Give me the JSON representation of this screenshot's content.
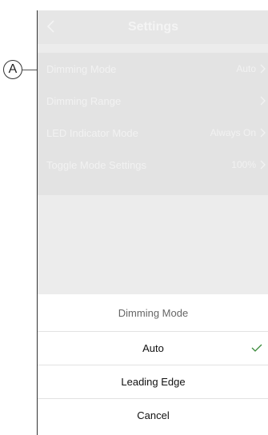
{
  "callout": {
    "label": "A"
  },
  "header": {
    "title": "Settings"
  },
  "settings": {
    "items": [
      {
        "label": "Dimming Mode",
        "value": "Auto"
      },
      {
        "label": "Dimming Range",
        "value": ""
      },
      {
        "label": "LED Indicator Mode",
        "value": "Always On"
      },
      {
        "label": "Toggle Mode Settings",
        "value": "100%"
      }
    ]
  },
  "sheet": {
    "title": "Dimming Mode",
    "options": [
      {
        "label": "Auto",
        "selected": true
      },
      {
        "label": "Leading Edge",
        "selected": false
      }
    ],
    "cancel_label": "Cancel"
  },
  "colors": {
    "check": "#3a8a3a",
    "dimmed_text": "#f2f2f2",
    "sheet_title": "#666666"
  }
}
